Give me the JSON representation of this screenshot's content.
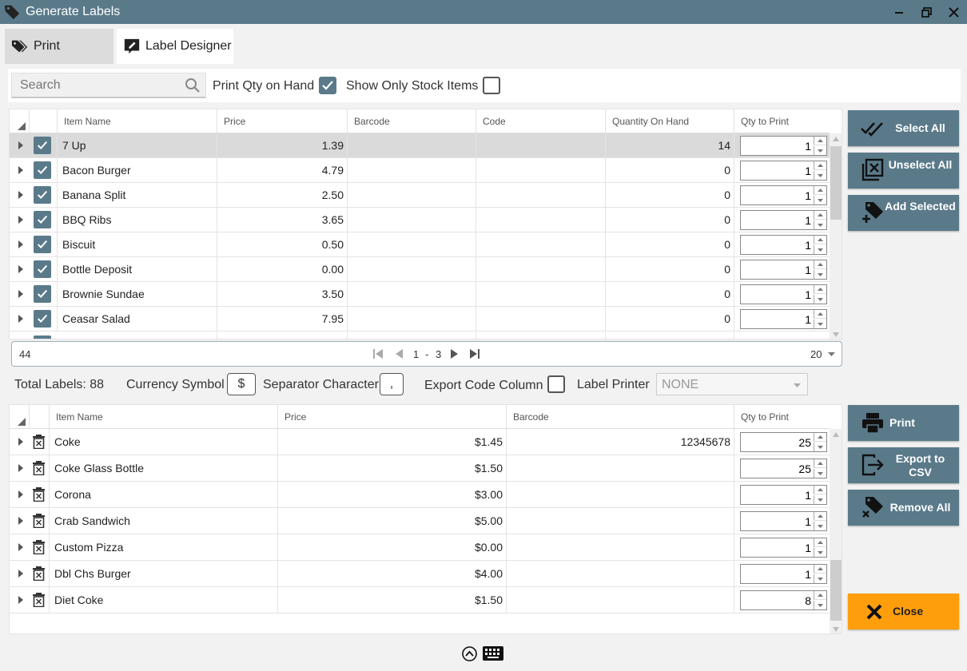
{
  "window": {
    "title": "Generate Labels",
    "icon": "tag-icon",
    "controls": [
      "minimize-icon",
      "restore-icon",
      "close-icon"
    ]
  },
  "tabs": [
    {
      "label": "Print",
      "icon": "tags-icon",
      "active": true
    },
    {
      "label": "Label Designer",
      "icon": "edit-label-icon",
      "active": false
    }
  ],
  "filters": {
    "search_placeholder": "Search",
    "print_qty_label": "Print Qty on Hand",
    "print_qty_checked": true,
    "show_stock_label": "Show Only Stock Items",
    "show_stock_checked": false
  },
  "items_grid": {
    "columns": [
      "Item Name",
      "Price",
      "Barcode",
      "Code",
      "Quantity On Hand",
      "Qty to Print"
    ],
    "rows": [
      {
        "name": "7 Up",
        "price": "1.39",
        "barcode": "",
        "code": "",
        "qoh": "14",
        "qty": "1",
        "checked": true,
        "selected": true
      },
      {
        "name": "Bacon Burger",
        "price": "4.79",
        "barcode": "",
        "code": "",
        "qoh": "0",
        "qty": "1",
        "checked": true
      },
      {
        "name": "Banana Split",
        "price": "2.50",
        "barcode": "",
        "code": "",
        "qoh": "0",
        "qty": "1",
        "checked": true
      },
      {
        "name": "BBQ Ribs",
        "price": "3.65",
        "barcode": "",
        "code": "",
        "qoh": "0",
        "qty": "1",
        "checked": true
      },
      {
        "name": "Biscuit",
        "price": "0.50",
        "barcode": "",
        "code": "",
        "qoh": "0",
        "qty": "1",
        "checked": true
      },
      {
        "name": "Bottle Deposit",
        "price": "0.00",
        "barcode": "",
        "code": "",
        "qoh": "0",
        "qty": "1",
        "checked": true
      },
      {
        "name": "Brownie Sundae",
        "price": "3.50",
        "barcode": "",
        "code": "",
        "qoh": "0",
        "qty": "1",
        "checked": true
      },
      {
        "name": "Ceasar Salad",
        "price": "7.95",
        "barcode": "",
        "code": "",
        "qoh": "0",
        "qty": "1",
        "checked": true
      }
    ]
  },
  "pager": {
    "total": "44",
    "page": "1",
    "separator": "-",
    "pages": "3",
    "page_size": "20"
  },
  "item_actions": {
    "select_all": "Select All",
    "unselect_all": "Unselect All",
    "add_selected": "Add Selected"
  },
  "options": {
    "total_labels": "Total Labels: 88",
    "currency_label": "Currency Symbol",
    "currency_value": "$",
    "separator_label": "Separator Character",
    "separator_value": ",",
    "export_code_label": "Export Code Column",
    "export_code_checked": false,
    "label_printer_label": "Label Printer",
    "label_printer_value": "NONE"
  },
  "labels_grid": {
    "columns": [
      "Item Name",
      "Price",
      "Barcode",
      "Qty to Print"
    ],
    "rows": [
      {
        "name": "Coke",
        "price": "$1.45",
        "barcode": "12345678",
        "qty": "25"
      },
      {
        "name": "Coke Glass Bottle",
        "price": "$1.50",
        "barcode": "",
        "qty": "25"
      },
      {
        "name": "Corona",
        "price": "$3.00",
        "barcode": "",
        "qty": "1"
      },
      {
        "name": "Crab Sandwich",
        "price": "$5.00",
        "barcode": "",
        "qty": "1"
      },
      {
        "name": "Custom Pizza",
        "price": "$0.00",
        "barcode": "",
        "qty": "1"
      },
      {
        "name": "Dbl Chs Burger",
        "price": "$4.00",
        "barcode": "",
        "qty": "1"
      },
      {
        "name": "Diet Coke",
        "price": "$1.50",
        "barcode": "",
        "qty": "8"
      }
    ]
  },
  "label_actions": {
    "print": "Print",
    "export_csv": "Export to CSV",
    "remove_all": "Remove All",
    "close": "Close"
  },
  "colors": {
    "accent": "#5a7a8a",
    "close": "#ff9e0d"
  }
}
